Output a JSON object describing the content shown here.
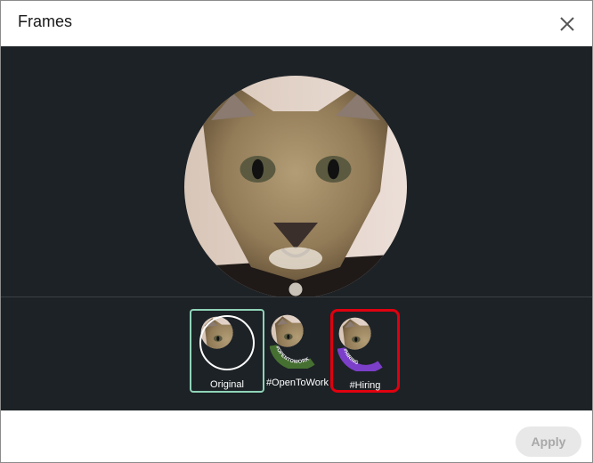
{
  "dialog": {
    "title": "Frames",
    "close_icon": "close-icon"
  },
  "frames": {
    "selected_index": 0,
    "options": [
      {
        "label": "Original",
        "ring_text": ""
      },
      {
        "label": "#OpenToWork",
        "ring_text": "#OPENTOWORK"
      },
      {
        "label": "#Hiring",
        "ring_text": "#HIRING"
      }
    ]
  },
  "footer": {
    "apply_label": "Apply"
  },
  "colors": {
    "stage_background": "#1d2226",
    "open_to_work_ring": "#467031",
    "hiring_ring": "#7c3fc9",
    "selected_border": "#8fd3b8",
    "highlight_border": "#e0000f"
  }
}
